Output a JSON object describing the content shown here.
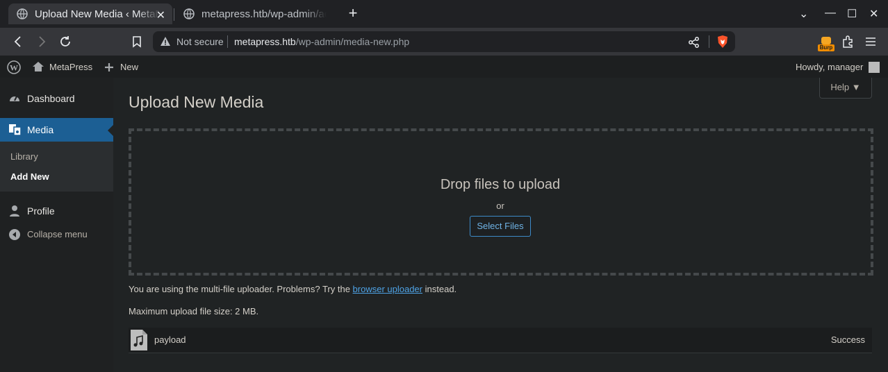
{
  "browser": {
    "tabs": [
      {
        "title": "Upload New Media ‹ MetaPress — WordPress",
        "active": true
      },
      {
        "title": "metapress.htb/wp-admin/admin-ajax.php",
        "active": false
      }
    ],
    "tab_close": "✕",
    "new_tab": "+",
    "window_controls": {
      "tab_list": "⌄",
      "minimize": "—",
      "maximize": "☐",
      "close": "✕"
    },
    "security_label": "Not secure",
    "url_host": "metapress.htb",
    "url_path": "/wp-admin/media-new.php",
    "extension_badge": "Burp"
  },
  "adminbar": {
    "site_name": "MetaPress",
    "new_label": "New",
    "howdy": "Howdy, manager"
  },
  "sidebar": {
    "dashboard": "Dashboard",
    "media": "Media",
    "library": "Library",
    "add_new": "Add New",
    "profile": "Profile",
    "collapse": "Collapse menu"
  },
  "main": {
    "title": "Upload New Media",
    "help": "Help ▼",
    "drop_title": "Drop files to upload",
    "drop_or": "or",
    "select_files": "Select Files",
    "uploader_info_pre": "You are using the multi-file uploader. Problems? Try the",
    "uploader_link": "browser uploader",
    "uploader_info_post": "instead.",
    "max_size": "Maximum upload file size: 2 MB.",
    "file": {
      "name": "payload",
      "status": "Success"
    }
  }
}
